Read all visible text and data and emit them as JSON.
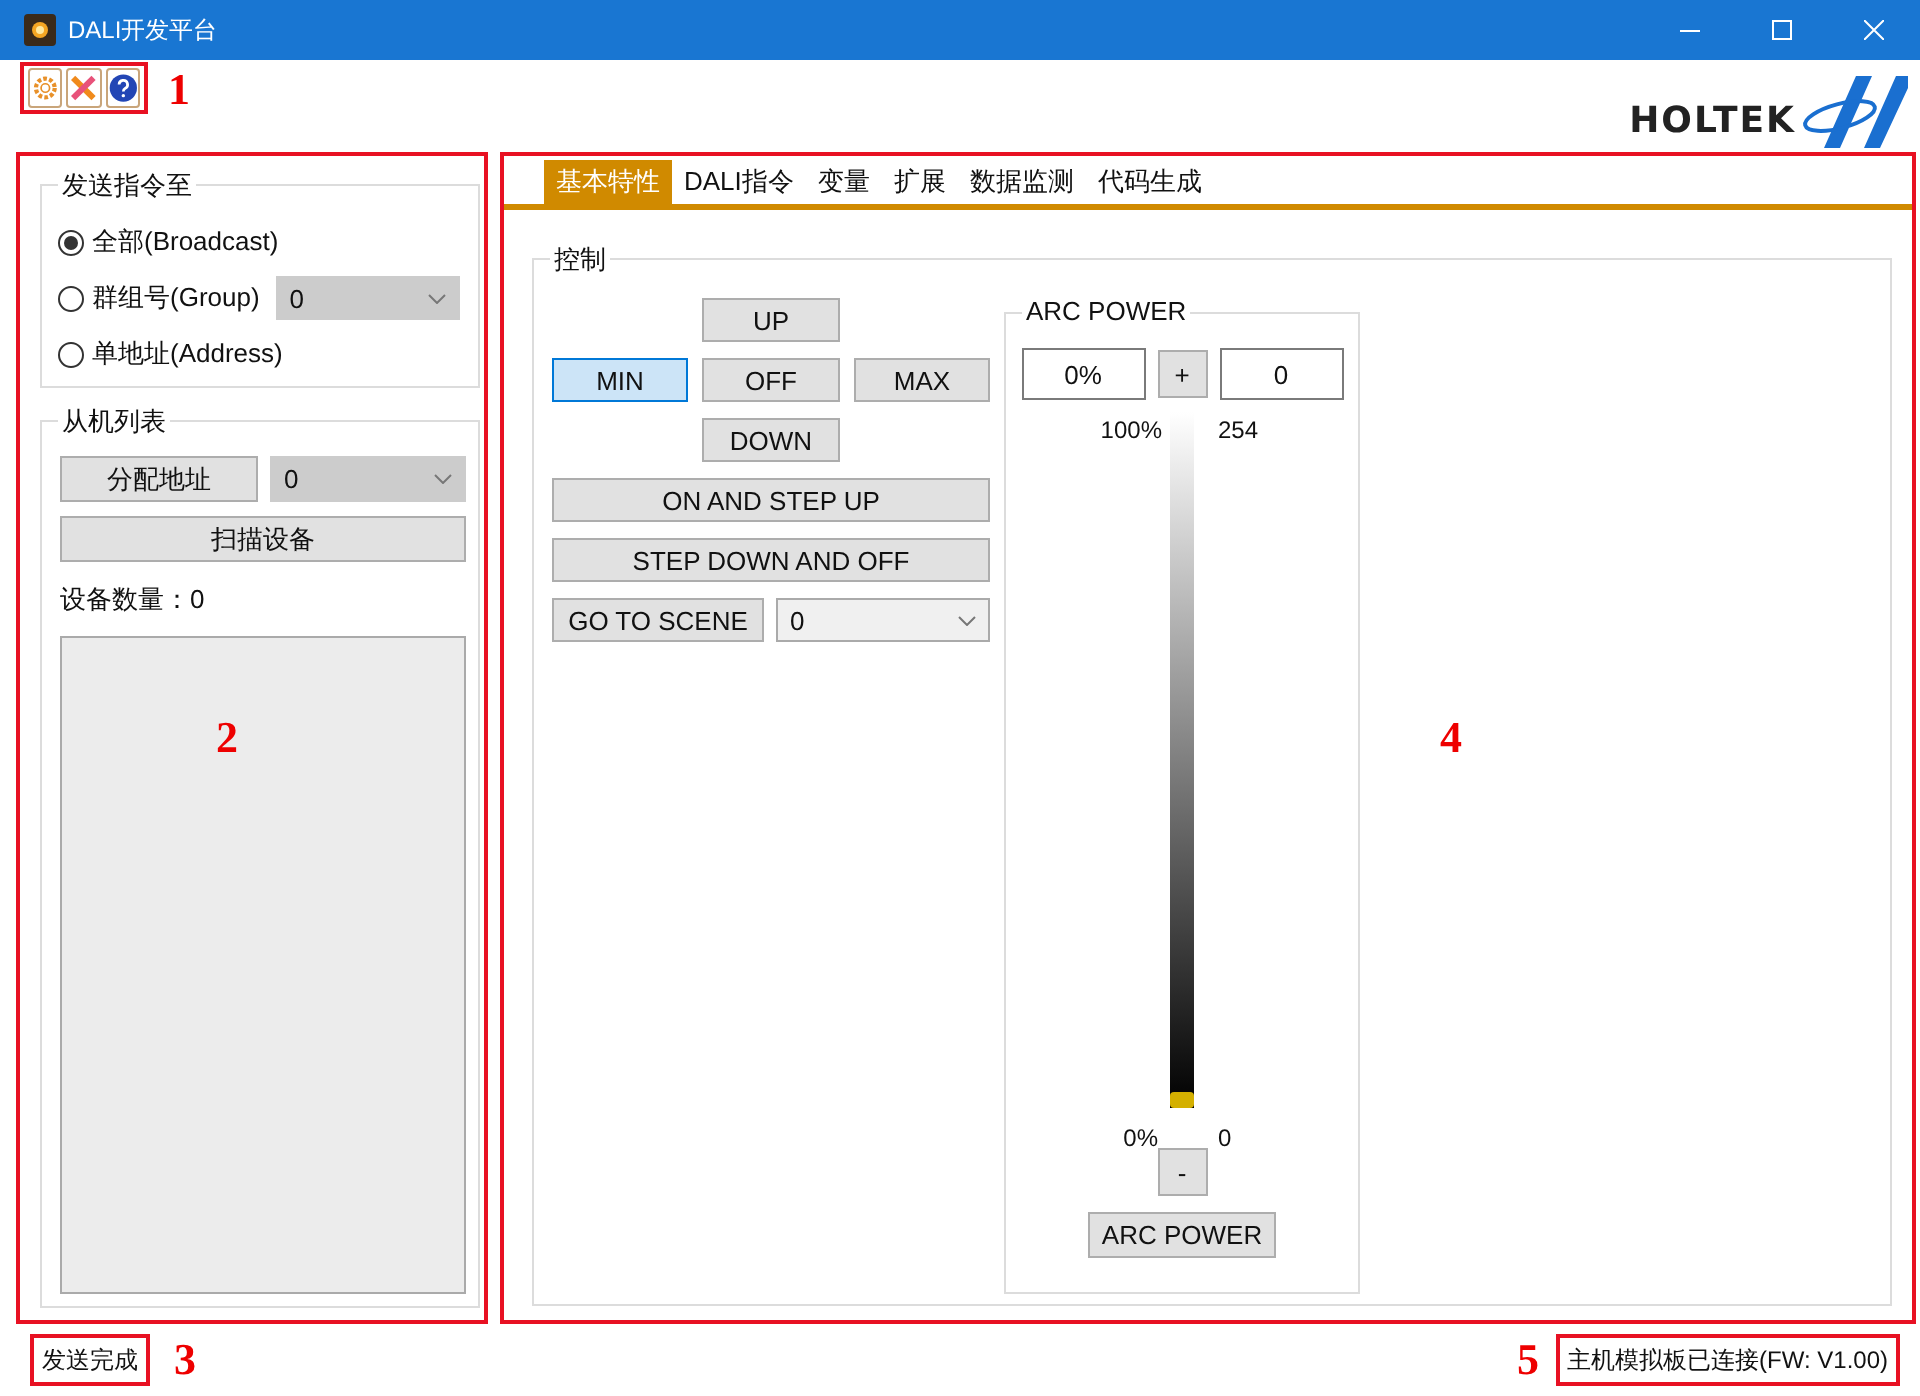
{
  "window": {
    "title": "DALI开发平台"
  },
  "toolbar": {
    "callout": "1"
  },
  "logo": {
    "text": "HOLTEK"
  },
  "send_target": {
    "title": "发送指令至",
    "options": [
      {
        "label": "全部(Broadcast)",
        "selected": true
      },
      {
        "label": "群组号(Group)",
        "selected": false,
        "dropdown": {
          "value": "0",
          "disabled": true
        }
      },
      {
        "label": "单地址(Address)",
        "selected": false
      }
    ]
  },
  "slave_list": {
    "title": "从机列表",
    "assign_button": "分配地址",
    "address_dropdown": "0",
    "scan_button": "扫描设备",
    "count_label": "设备数量：0"
  },
  "left_callout": "2",
  "tabs": [
    {
      "label": "基本特性",
      "selected": true
    },
    {
      "label": "DALI指令",
      "selected": false
    },
    {
      "label": "变量",
      "selected": false
    },
    {
      "label": "扩展",
      "selected": false
    },
    {
      "label": "数据监测",
      "selected": false
    },
    {
      "label": "代码生成",
      "selected": false
    }
  ],
  "control": {
    "title": "控制",
    "pad": [
      {
        "label": "UP",
        "selected": false
      },
      {
        "label": "MIN",
        "selected": true
      },
      {
        "label": "OFF",
        "selected": false
      },
      {
        "label": "MAX",
        "selected": false
      },
      {
        "label": "DOWN",
        "selected": false
      }
    ],
    "wide_buttons": [
      "ON AND STEP UP",
      "STEP DOWN AND OFF"
    ],
    "scene_button": "GO TO SCENE",
    "scene_dropdown": "0",
    "arc_power": {
      "title": "ARC POWER",
      "percent_field": "0%",
      "plus": "+",
      "value_field": "0",
      "top_percent": "100%",
      "top_value": "254",
      "level": 0,
      "bottom_percent": "0%",
      "bottom_value": "0",
      "minus": "-",
      "button": "ARC POWER"
    }
  },
  "right_callout": "4",
  "status_bar": {
    "message": "发送完成",
    "message_callout": "3",
    "connection": "主机模拟板已连接(FW: V1.00)",
    "connection_callout": "5"
  }
}
